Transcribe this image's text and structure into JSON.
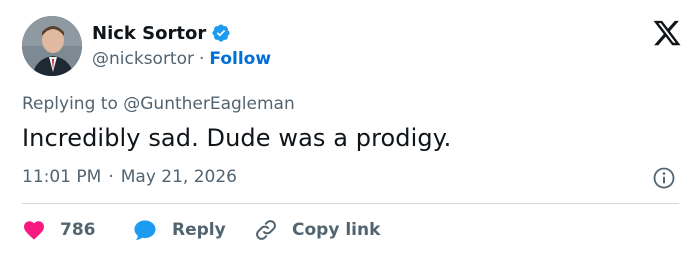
{
  "author": {
    "display_name": "Nick Sortor",
    "handle": "@nicksortor",
    "separator": "·",
    "follow_label": "Follow",
    "verified": true
  },
  "reply_context": {
    "prefix": "Replying to",
    "mention": "@GuntherEagleman"
  },
  "tweet": {
    "text": "Incredibly sad. Dude was a prodigy.",
    "time": "11:01 PM",
    "separator": "·",
    "date": "May 21, 2026"
  },
  "actions": {
    "likes_count": "786",
    "reply_label": "Reply",
    "copy_link_label": "Copy link"
  },
  "icons": {
    "verified": "verified-badge-icon",
    "brand": "x-logo-icon",
    "info": "info-icon",
    "like": "heart-icon",
    "reply": "speech-bubble-icon",
    "copy_link": "link-icon"
  },
  "colors": {
    "text_primary": "#0f1419",
    "text_secondary": "#536471",
    "link_blue": "#006fd6",
    "verified_blue": "#1d9bf0",
    "like_red": "#f91880",
    "divider": "#cfd9de"
  }
}
